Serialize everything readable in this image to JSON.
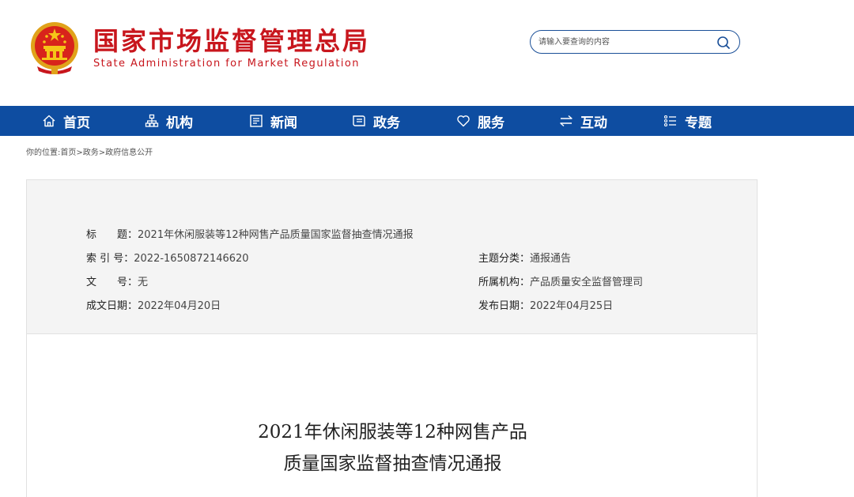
{
  "site": {
    "title_cn": "国家市场监督管理总局",
    "title_en": "State Administration for Market Regulation"
  },
  "search": {
    "placeholder": "请输入要查询的内容",
    "icon": "search-icon"
  },
  "nav": {
    "items": [
      {
        "label": "首页",
        "icon": "home-icon"
      },
      {
        "label": "机构",
        "icon": "org-chart-icon"
      },
      {
        "label": "新闻",
        "icon": "newspaper-icon"
      },
      {
        "label": "政务",
        "icon": "document-icon"
      },
      {
        "label": "服务",
        "icon": "heart-icon"
      },
      {
        "label": "互动",
        "icon": "exchange-icon"
      },
      {
        "label": "专题",
        "icon": "list-icon"
      }
    ],
    "color": "#0e4da1"
  },
  "breadcrumb": "你的位置:首页>政务>政府信息公开",
  "meta": {
    "title_key": "标　　题：",
    "title_val": "2021年休闲服装等12种网售产品质量国家监督抽查情况通报",
    "index_key": "索 引 号：",
    "index_val": "2022-1650872146620",
    "category_key": "主题分类：",
    "category_val": "通报通告",
    "docno_key": "文　　号：",
    "docno_val": "无",
    "org_key": "所属机构：",
    "org_val": "产品质量安全监督管理司",
    "created_key": "成文日期：",
    "created_val": "2022年04月20日",
    "published_key": "发布日期：",
    "published_val": "2022年04月25日"
  },
  "article": {
    "title_line1": "2021年休闲服装等12种网售产品",
    "title_line2": "质量国家监督抽查情况通报"
  },
  "colors": {
    "brand_red": "#c8161d",
    "nav_blue": "#0e4da1",
    "meta_bg": "#f4f4f4"
  }
}
